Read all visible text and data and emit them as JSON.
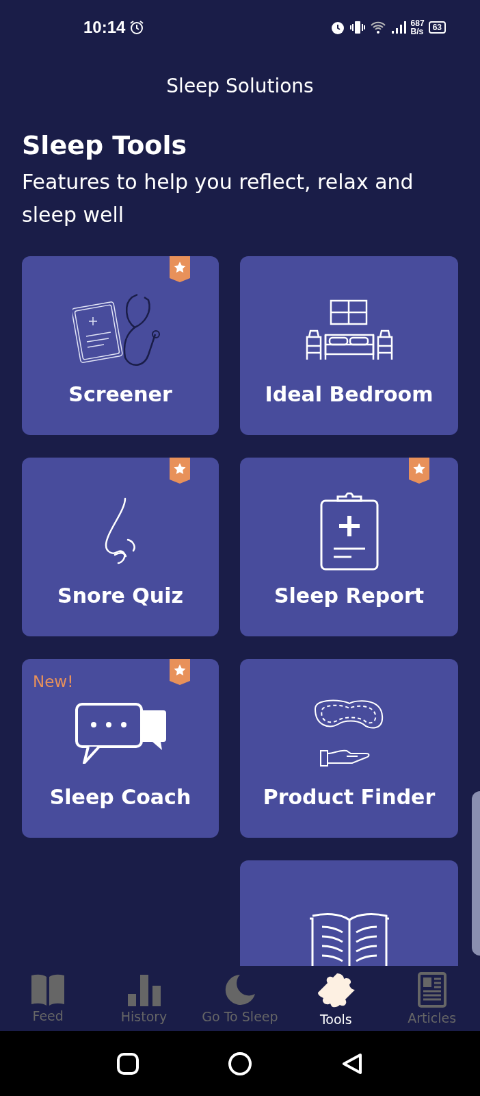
{
  "status_bar": {
    "time": "10:14",
    "net_speed": "687",
    "net_unit": "B/s",
    "battery": "63"
  },
  "app_bar": {
    "title": "Sleep Solutions"
  },
  "section": {
    "heading": "Sleep Tools",
    "subtitle": "Features to help you reflect, relax and sleep well"
  },
  "tools": [
    {
      "kind": "screener",
      "label": "Screener",
      "starred": true
    },
    {
      "kind": "bedroom",
      "label": "Ideal Bedroom",
      "starred": false
    },
    {
      "kind": "nose",
      "label": "Snore Quiz",
      "starred": true
    },
    {
      "kind": "report",
      "label": "Sleep Report",
      "starred": true
    },
    {
      "kind": "chat",
      "label": "Sleep Coach",
      "starred": true,
      "badge": "New!"
    },
    {
      "kind": "mask",
      "label": "Product Finder",
      "starred": false
    },
    {
      "kind": "book",
      "starred": false
    }
  ],
  "bottom_nav": [
    {
      "kind": "feed",
      "label": "Feed",
      "selected": false
    },
    {
      "kind": "history",
      "label": "History",
      "selected": false
    },
    {
      "kind": "sleep",
      "label": "Go To Sleep",
      "selected": false
    },
    {
      "kind": "tools",
      "label": "Tools",
      "selected": true
    },
    {
      "kind": "articles",
      "label": "Articles",
      "selected": false
    }
  ]
}
